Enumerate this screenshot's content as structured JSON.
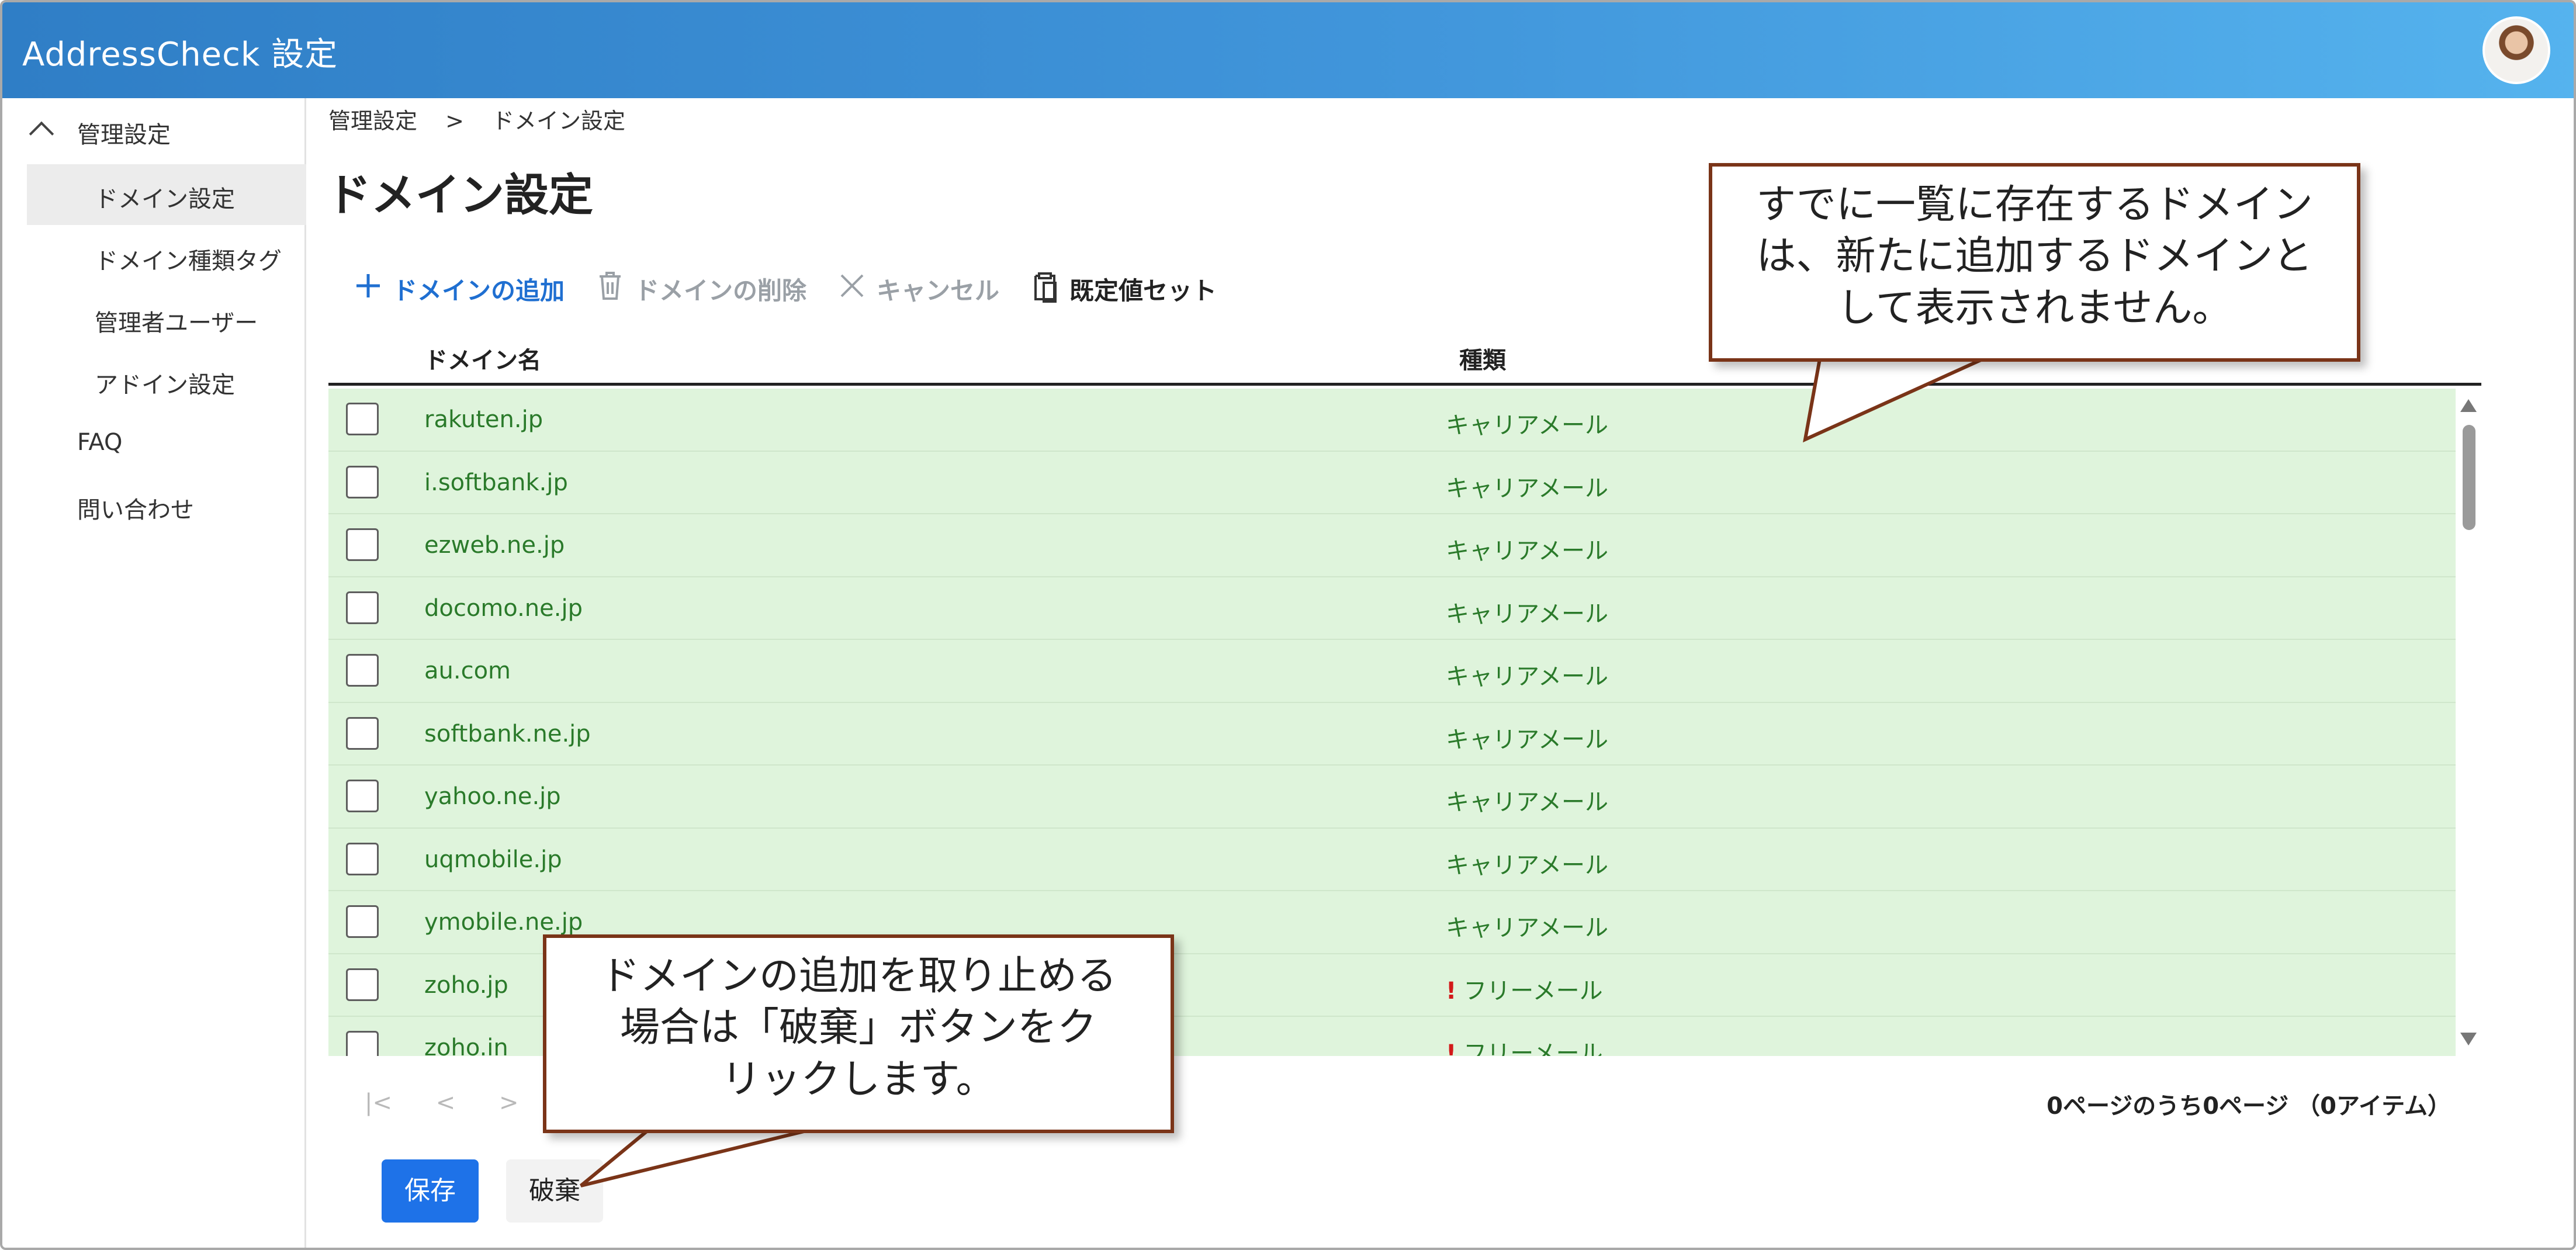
{
  "app": {
    "title": "AddressCheck 設定"
  },
  "sidebar": {
    "section": "管理設定",
    "items": [
      {
        "label": "ドメイン設定"
      },
      {
        "label": "ドメイン種類タグ"
      },
      {
        "label": "管理者ユーザー"
      },
      {
        "label": "アドイン設定"
      }
    ],
    "faq": "FAQ",
    "contact": "問い合わせ"
  },
  "breadcrumb": {
    "root": "管理設定",
    "sep": ">",
    "current": "ドメイン設定"
  },
  "page": {
    "title": "ドメイン設定"
  },
  "toolbar": {
    "add": "ドメインの追加",
    "delete": "ドメインの削除",
    "cancel": "キャンセル",
    "defaults": "既定値セット"
  },
  "grid": {
    "col_domain": "ドメイン名",
    "col_type": "種類",
    "rows": [
      {
        "domain": "rakuten.jp",
        "type": "キャリアメール",
        "warn": ""
      },
      {
        "domain": "i.softbank.jp",
        "type": "キャリアメール",
        "warn": ""
      },
      {
        "domain": "ezweb.ne.jp",
        "type": "キャリアメール",
        "warn": ""
      },
      {
        "domain": "docomo.ne.jp",
        "type": "キャリアメール",
        "warn": ""
      },
      {
        "domain": "au.com",
        "type": "キャリアメール",
        "warn": ""
      },
      {
        "domain": "softbank.ne.jp",
        "type": "キャリアメール",
        "warn": ""
      },
      {
        "domain": "yahoo.ne.jp",
        "type": "キャリアメール",
        "warn": ""
      },
      {
        "domain": "uqmobile.jp",
        "type": "キャリアメール",
        "warn": ""
      },
      {
        "domain": "ymobile.ne.jp",
        "type": "キャリアメール",
        "warn": ""
      },
      {
        "domain": "zoho.jp",
        "type": "フリーメール",
        "warn": "!"
      },
      {
        "domain": "zoho.in",
        "type": "フリーメール",
        "warn": "!"
      }
    ]
  },
  "pager": {
    "first": "|<",
    "prev": "<",
    "next": ">",
    "last": ">|",
    "info": "0ページのうち0ページ （0アイテム）"
  },
  "actions": {
    "save": "保存",
    "discard": "破棄"
  },
  "callouts": {
    "top_right": [
      "すでに一覧に存在するドメイン",
      "は、新たに追加するドメインと",
      "して表示されません。"
    ],
    "bottom": [
      "ドメインの追加を取り止める",
      "場合は「破棄」ボタンをク",
      "リックします。"
    ]
  },
  "colors": {
    "header_start": "#2f7ec6",
    "header_end": "#55b3ee",
    "row_bg": "#dff4dc",
    "row_text": "#2a7a2a",
    "primary": "#1e72e8",
    "callout_border": "#7a3418"
  }
}
